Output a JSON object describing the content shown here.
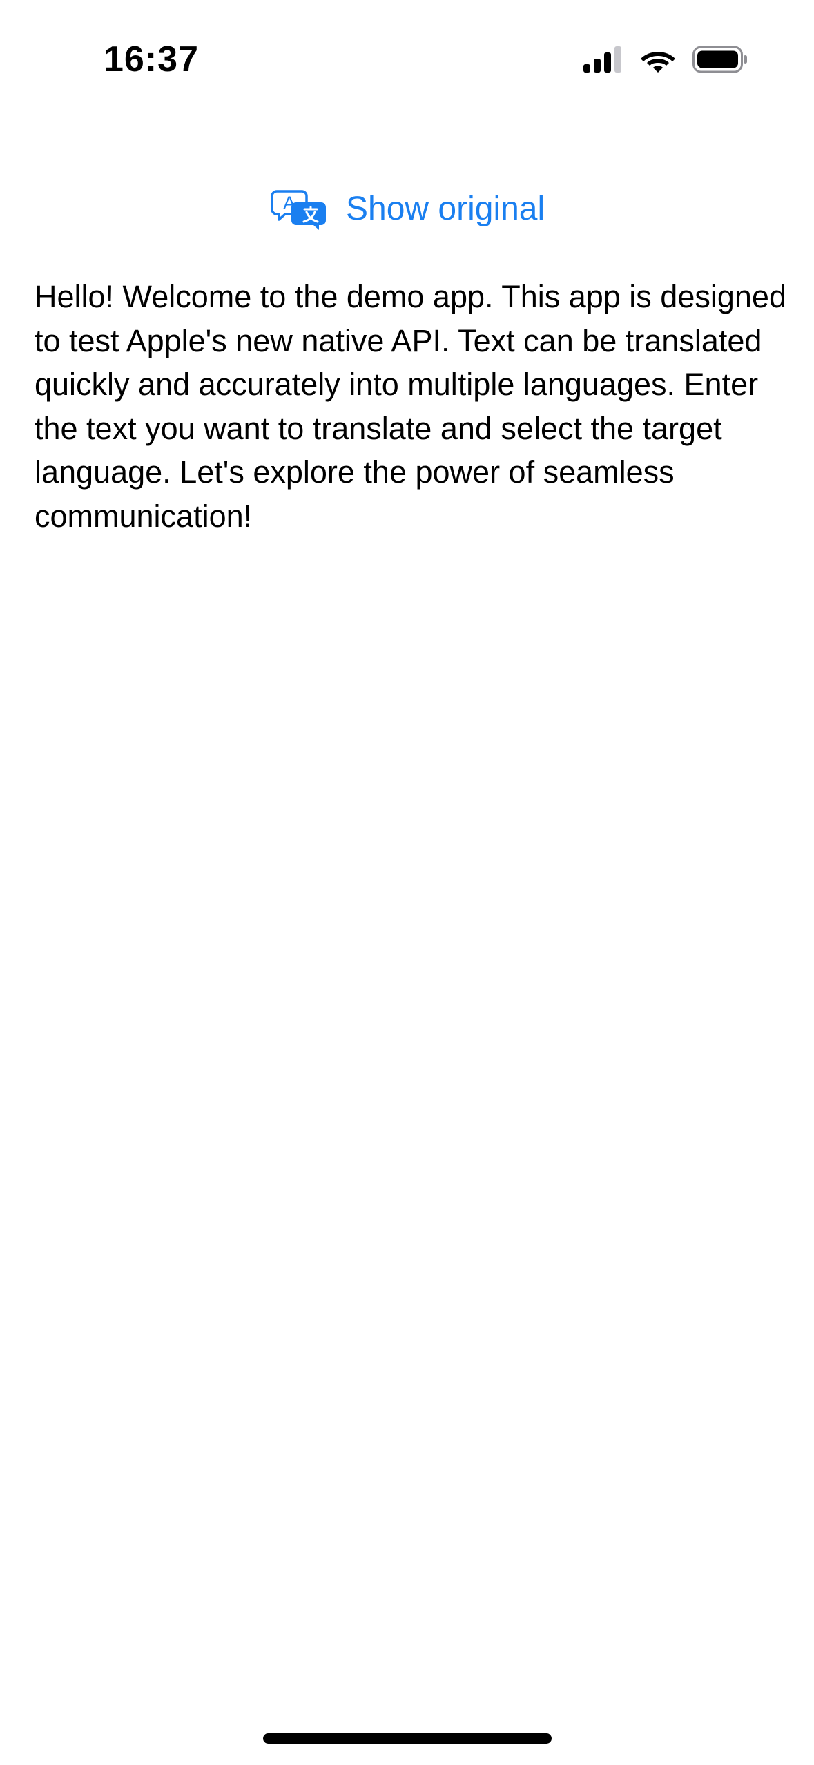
{
  "status_bar": {
    "time": "16:37",
    "icons": [
      "cellular-signal-icon",
      "wifi-icon",
      "battery-icon"
    ]
  },
  "translation": {
    "toggle_label": "Show original",
    "icon": "translate-icon",
    "accent_color": "#1a7ff0"
  },
  "content": {
    "text": "Hello! Welcome to the demo app. This app is designed to test Apple's new native API. Text can be translated quickly and accurately into multiple languages. Enter the text you want to translate and select the target language. Let's explore the power of seamless communication!"
  }
}
